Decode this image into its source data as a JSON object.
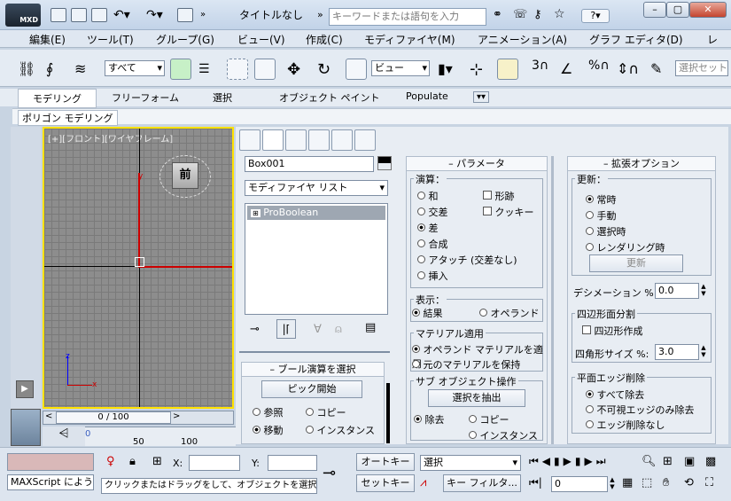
{
  "title": {
    "logo": "MXD",
    "window_title": "タイトルなし",
    "search_placeholder": "キーワードまたは語句を入力",
    "help": "?"
  },
  "menu": [
    "編集(E)",
    "ツール(T)",
    "グループ(G)",
    "ビュー(V)",
    "作成(C)",
    "モディファイヤ(M)",
    "アニメーション(A)",
    "グラフ エディタ(D)",
    "レ"
  ],
  "toolbar": {
    "selection_filter": "すべて",
    "ref_coord": "ビュー",
    "snap_label": "3",
    "percent_label": "%",
    "named_sel_placeholder": "選択セット"
  },
  "ribbon": {
    "tabs": [
      "モデリング",
      "フリーフォーム",
      "選択",
      "オブジェクト ペイント",
      "Populate"
    ],
    "sub_tab": "ポリゴン モデリング"
  },
  "viewport": {
    "label": "[+][フロント][ワイヤフレーム]",
    "cube_face": "前",
    "axis_x": "x",
    "axis_z": "z",
    "axis_y": "y",
    "time_slider": "0 / 100",
    "ruler": [
      "0",
      "50",
      "100"
    ]
  },
  "cmdpanel": {
    "object_name": "Box001",
    "object_color": "#000000",
    "modifier_list": "モディファイヤ リスト",
    "stack_item": "ProBoolean",
    "pick_rollout": {
      "title": "ブール演算を選択",
      "pick_button": "ピック開始",
      "opts": [
        "参照",
        "コピー",
        "移動",
        "インスタンス"
      ]
    },
    "params": {
      "title": "パラメータ",
      "op_group": "演算：",
      "ops": [
        "和",
        "交差",
        "差",
        "合成",
        "アタッチ (交差なし)",
        "挿入"
      ],
      "checks": [
        "形跡",
        "クッキー"
      ],
      "display_group": "表示：",
      "display_opts": [
        "結果",
        "オペランド"
      ],
      "material_group": "マテリアル適用",
      "material_opts": [
        "オペランド マテリアルを適用",
        "元のマテリアルを保持"
      ],
      "subobj_group": "サブ オブジェクト操作",
      "extract_button": "選択を抽出",
      "extract_opts": [
        "除去",
        "コピー",
        "インスタンス"
      ]
    },
    "advanced": {
      "title": "拡張オプション",
      "update_group": "更新：",
      "update_opts": [
        "常時",
        "手動",
        "選択時",
        "レンダリング時"
      ],
      "update_button": "更新",
      "decimation_label": "デシメーション %:",
      "decimation_value": "0.0",
      "quad_group": "四辺形面分割",
      "quad_check": "四辺形作成",
      "quad_size_label": "四角形サイズ %:",
      "quad_size_value": "3.0",
      "planar_group": "平面エッジ削除",
      "planar_opts": [
        "すべて除去",
        "不可視エッジのみ除去",
        "エッジ削除なし"
      ]
    }
  },
  "status": {
    "maxscript": "MAXScript によう",
    "prompt": "クリックまたはドラッグをして、オブジェクトを選択します",
    "x_label": "X:",
    "y_label": "Y:",
    "auto_key": "オートキー",
    "set_key": "セットキー",
    "key_mode": "選択",
    "key_filters": "キー フィルタ...",
    "frame": "0"
  }
}
